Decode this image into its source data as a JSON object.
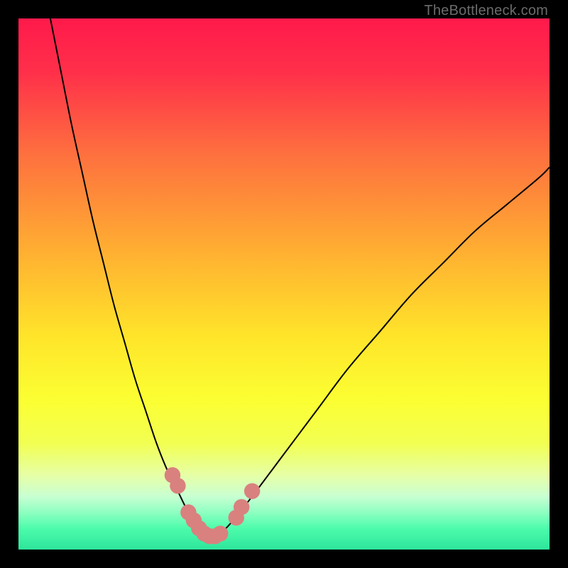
{
  "watermark": "TheBottleneck.com",
  "chart_data": {
    "type": "line",
    "title": "",
    "xlabel": "",
    "ylabel": "",
    "xlim": [
      0,
      100
    ],
    "ylim": [
      0,
      100
    ],
    "gradient_stops": [
      {
        "pct": 0,
        "color": "#ff1a4b"
      },
      {
        "pct": 10,
        "color": "#ff2f4a"
      },
      {
        "pct": 25,
        "color": "#fe6e3f"
      },
      {
        "pct": 45,
        "color": "#ffb331"
      },
      {
        "pct": 60,
        "color": "#ffe52a"
      },
      {
        "pct": 72,
        "color": "#fbff32"
      },
      {
        "pct": 80,
        "color": "#f2ff52"
      },
      {
        "pct": 86,
        "color": "#e6ffa6"
      },
      {
        "pct": 90,
        "color": "#c8ffd2"
      },
      {
        "pct": 93,
        "color": "#8effc1"
      },
      {
        "pct": 96,
        "color": "#4dfcac"
      },
      {
        "pct": 100,
        "color": "#2de59b"
      }
    ],
    "series": [
      {
        "name": "bottleneck-curve",
        "color": "#000000",
        "x": [
          6,
          8,
          10,
          12,
          14,
          16,
          18,
          20,
          22,
          24,
          26,
          28,
          30,
          32,
          34,
          35,
          36,
          37,
          38,
          40,
          44,
          50,
          56,
          62,
          68,
          74,
          80,
          86,
          92,
          98,
          100
        ],
        "y": [
          100,
          90,
          80,
          71,
          62,
          54,
          46,
          39,
          32,
          26,
          20,
          15,
          11,
          7,
          4,
          3,
          2,
          2,
          3,
          5,
          10,
          18,
          26,
          34,
          41,
          48,
          54,
          60,
          65,
          70,
          72
        ]
      }
    ],
    "marker_points": {
      "name": "highlighted-markers",
      "color": "#d9817f",
      "x": [
        29,
        30,
        32,
        33,
        34,
        35,
        36,
        37,
        38,
        41,
        42,
        44
      ],
      "y": [
        14,
        12,
        7,
        5.5,
        4,
        3,
        2.5,
        2.5,
        3,
        6,
        8,
        11
      ]
    }
  }
}
